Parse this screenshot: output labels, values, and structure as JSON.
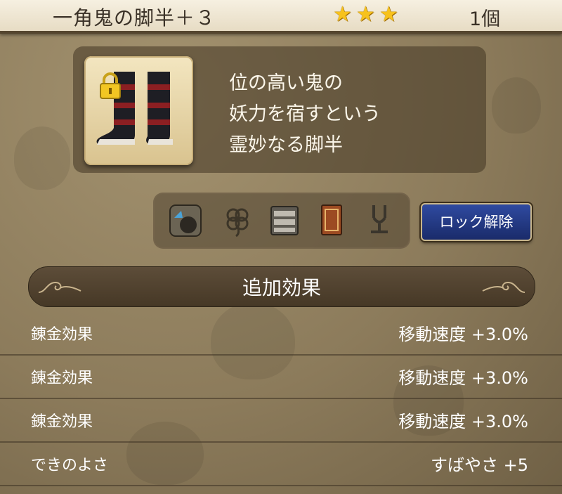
{
  "header": {
    "item_name": "一角鬼の脚半＋３",
    "stars": 3,
    "star_glyph": "★",
    "count": "1個"
  },
  "item": {
    "icon": "boots-icon",
    "locked": true,
    "description": [
      "位の高い鬼の",
      "妖力を宿すという",
      "霊妙なる脚半"
    ]
  },
  "status_icons": [
    "dice-bag-icon",
    "clover-icon",
    "cabinet-icon",
    "book-icon",
    "tuning-fork-icon"
  ],
  "unlock_button": {
    "label": "ロック解除"
  },
  "section": {
    "title": "追加効果"
  },
  "effects": [
    {
      "label": "錬金効果",
      "value": "移動速度 +3.0%"
    },
    {
      "label": "錬金効果",
      "value": "移動速度 +3.0%"
    },
    {
      "label": "錬金効果",
      "value": "移動速度 +3.0%"
    },
    {
      "label": "できのよさ",
      "value": "すばやさ +5"
    }
  ],
  "colors": {
    "accent_star": "#f7c21d",
    "button_blue": "#1a2b6a",
    "text_light": "#ffffff"
  }
}
